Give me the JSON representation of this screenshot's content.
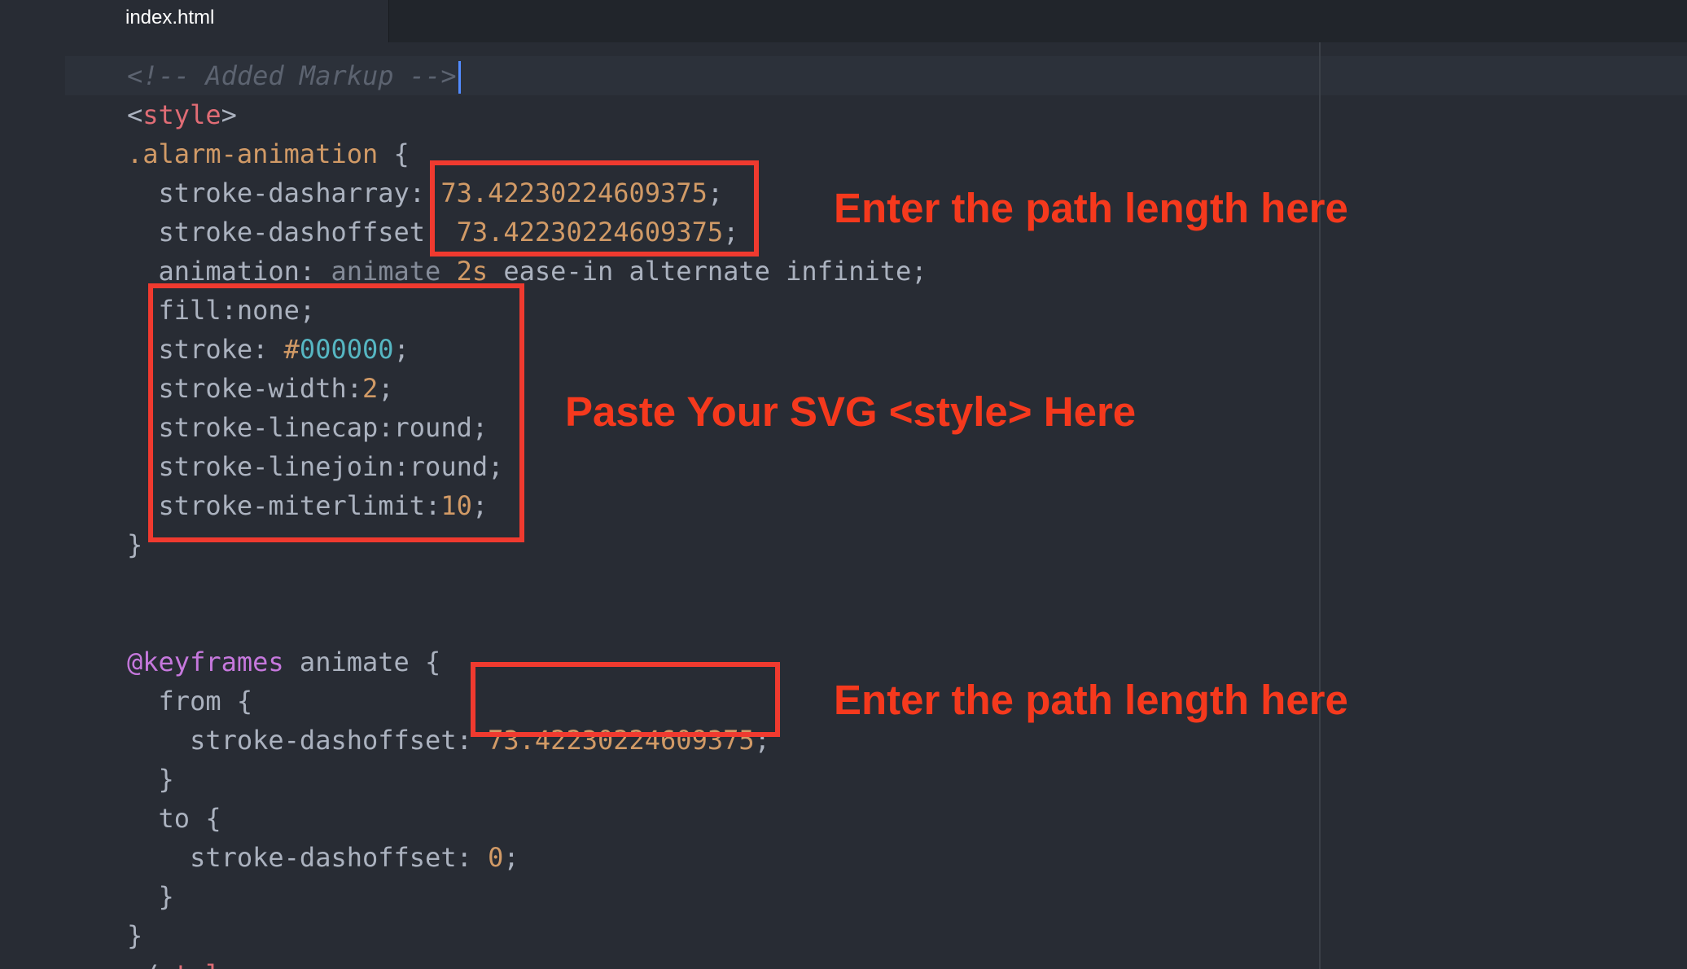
{
  "tab": {
    "filename": "index.html"
  },
  "code": {
    "comment": "<!-- Added Markup -->",
    "style_open_lt": "<",
    "style_tag": "style",
    "style_open_gt": ">",
    "selector": ".alarm-animation",
    "brace_open": " {",
    "dasharray_prop": "stroke-dasharray: ",
    "dasharray_val": "73.42230224609375",
    "dashoffset_prop": "stroke-dashoffset  ",
    "dashoffset_val": "73.42230224609375",
    "animation_prop": "animation: ",
    "animation_name": "animate ",
    "animation_dur": "2s",
    "animation_rest": " ease-in alternate infinite;",
    "fill_line": "fill:none;",
    "stroke_prop": "stroke: ",
    "stroke_hash": "#",
    "stroke_hex": "000000",
    "strokewidth_prop": "stroke-width:",
    "strokewidth_val": "2",
    "linecap_line": "stroke-linecap:round;",
    "linejoin_line": "stroke-linejoin:round;",
    "miter_prop": "stroke-miterlimit:",
    "miter_val": "10",
    "semicolon": ";",
    "brace_close": "}",
    "at_keyframes": "@keyframes",
    "keyframes_name": " animate {",
    "from_line": "from {",
    "from_prop": "stroke-dashoffset: ",
    "from_val": "73.42230224609375",
    "to_line": "to {",
    "to_prop": "stroke-dashoffset: ",
    "to_val": "0",
    "style_close_lt": "</",
    "style_close_tag": "style",
    "style_close_gt": ">"
  },
  "annotations": {
    "path_length_1": "Enter the path length here",
    "svg_style": "Paste Your SVG <style> Here",
    "path_length_2": "Enter the path length here"
  },
  "colors": {
    "annotation_red": "#f03a2f",
    "editor_bg": "#282c34",
    "tabbar_bg": "#21252b"
  }
}
